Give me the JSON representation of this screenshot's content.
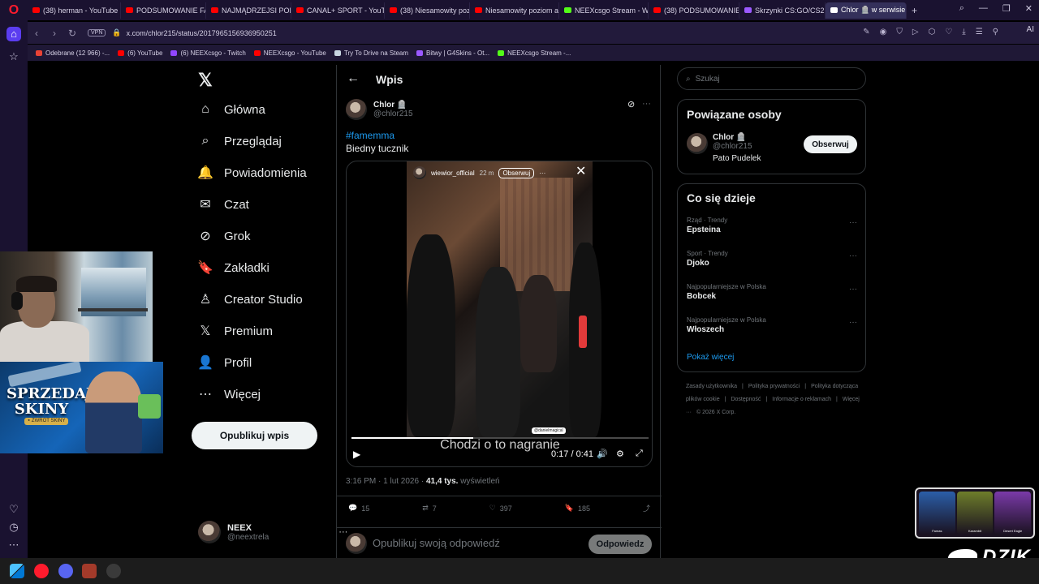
{
  "browser": {
    "tabs": [
      {
        "title": "(38) herman - YouTube",
        "color": "#ff0000"
      },
      {
        "title": "PODSUMOWANIE FAME",
        "color": "#ff0000"
      },
      {
        "title": "NAJMĄDRZEJSI POLITYC",
        "color": "#ff0000"
      },
      {
        "title": "CANAL+ SPORT - YouTu",
        "color": "#ff0000"
      },
      {
        "title": "(38) Niesamowity pozio",
        "color": "#ff0000"
      },
      {
        "title": "Niesamowity poziom ag",
        "color": "#ff0000"
      },
      {
        "title": "NEEXcsgo Stream - Wat",
        "color": "#53fc18"
      },
      {
        "title": "(38) PODSUMOWANIE F",
        "color": "#ff0000"
      },
      {
        "title": "Skrzynki CS:GO/CS2 | G",
        "color": "#9b59ff"
      },
      {
        "title": "Chlor 🪦 w serwisie X: „#",
        "color": "#ffffff"
      }
    ],
    "new_tab": "+",
    "url": "x.com/chlor215/status/2017965156936950251",
    "vpn_label": "VPN",
    "ai_label": "AI",
    "bookmarks": [
      {
        "label": "Odebrane (12 966) -...",
        "color": "#ea4335"
      },
      {
        "label": "(6) YouTube",
        "color": "#ff0000"
      },
      {
        "label": "(6) NEEXcsgo - Twitch",
        "color": "#9146ff"
      },
      {
        "label": "NEEXcsgo - YouTube",
        "color": "#ff0000"
      },
      {
        "label": "Try To Drive na Steam",
        "color": "#c7d5e0"
      },
      {
        "label": "Bitwy | G4Skins - Ot...",
        "color": "#9b59ff"
      },
      {
        "label": "NEEXcsgo Stream -...",
        "color": "#53fc18"
      }
    ]
  },
  "nav": {
    "logo": "𝕏",
    "items": [
      {
        "label": "Główna",
        "icon": "⌂"
      },
      {
        "label": "Przeglądaj",
        "icon": "⌕"
      },
      {
        "label": "Powiadomienia",
        "icon": "🔔"
      },
      {
        "label": "Czat",
        "icon": "✉"
      },
      {
        "label": "Grok",
        "icon": "⊘"
      },
      {
        "label": "Zakładki",
        "icon": "🔖"
      },
      {
        "label": "Creator Studio",
        "icon": "♙"
      },
      {
        "label": "Premium",
        "icon": "𝕏"
      },
      {
        "label": "Profil",
        "icon": "👤"
      },
      {
        "label": "Więcej",
        "icon": "⋯"
      }
    ],
    "post_button": "Opublikuj wpis",
    "account": {
      "name": "NEEX",
      "handle": "@neextrela",
      "more": "···"
    }
  },
  "post": {
    "header_title": "Wpis",
    "back": "←",
    "author_name": "Chlor 🪦",
    "author_handle": "@chlor215",
    "hashtag": "#famemma",
    "text": "Biedny tucznik",
    "video": {
      "overlay_user": "wiewior_official",
      "overlay_time": "22 m",
      "overlay_follow": "Obserwuj",
      "overlay_more": "···",
      "overlay_tag": "@danielmagical",
      "subtitle": "Chodzi o to nagranie",
      "current_time": "0:17",
      "separator": "/",
      "duration": "0:41",
      "progress": 0.41
    },
    "timestamp": "3:16 PM · 1 lut 2026 ·",
    "views_count": "41,4 tys.",
    "views_label": "wyświetleń",
    "replies": "15",
    "reposts": "7",
    "likes": "397",
    "bookmarks": "185",
    "reply_placeholder": "Opublikuj swoją odpowiedź",
    "reply_button": "Odpowiedz"
  },
  "right": {
    "search_placeholder": "Szukaj",
    "related_title": "Powiązane osoby",
    "related_person": {
      "name": "Chlor 🪦",
      "handle": "@chlor215",
      "bio": "Pato Pudelek",
      "follow": "Obserwuj"
    },
    "trends_title": "Co się dzieje",
    "trends": [
      {
        "category": "Rząd · Trendy",
        "name": "Epsteina"
      },
      {
        "category": "Sport · Trendy",
        "name": "Djoko"
      },
      {
        "category": "Najpopularniejsze w Polska",
        "name": "Bobcek"
      },
      {
        "category": "Najpopularniejsze w Polska",
        "name": "Włoszech"
      }
    ],
    "show_more": "Pokaż więcej",
    "footer": [
      "Zasady użytkownika",
      "|",
      "Polityka prywatności",
      "|",
      "Polityka dotycząca plików cookie",
      "|",
      "Dostępność",
      "|",
      "Informacje o reklamach",
      "|",
      "Więcej ···",
      "© 2026 X Corp."
    ]
  },
  "overlays": {
    "ad_title": "SPRZEDAJ SKINY",
    "ad_badge": "⭑ ZWROT SKINY",
    "skins": [
      {
        "label": "Famas",
        "color": "#2b5ea8"
      },
      {
        "label": "Karambit",
        "color": "#6e7d2a"
      },
      {
        "label": "Desert Eagle",
        "color": "#7a3aa8"
      }
    ],
    "dzik_label": "DZIK"
  }
}
